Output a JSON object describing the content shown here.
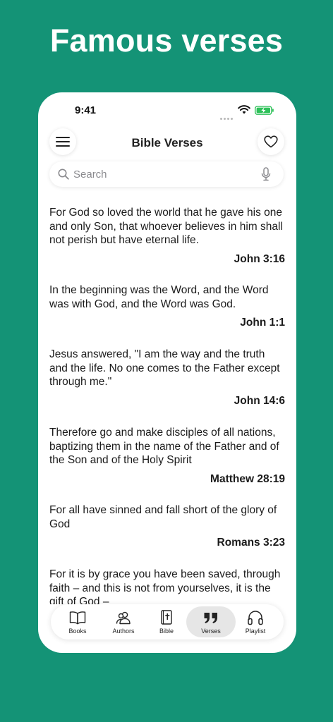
{
  "headline": "Famous verses",
  "status_bar": {
    "time": "9:41"
  },
  "navbar": {
    "title": "Bible Verses"
  },
  "search": {
    "placeholder": "Search"
  },
  "verses": [
    {
      "text": "For God so loved the world that he gave his one and only Son, that whoever believes in him shall not perish but have eternal life.",
      "reference": "John 3:16"
    },
    {
      "text": "In the beginning was the Word, and the Word was with God, and the Word was God.",
      "reference": "John 1:1"
    },
    {
      "text": "Jesus answered, \"I am the way and the truth and the life. No one comes to the Father except through me.\"",
      "reference": "John 14:6"
    },
    {
      "text": "Therefore go and make disciples of all nations, baptizing them in the name of the Father and of the Son and of the Holy Spirit",
      "reference": "Matthew 28:19"
    },
    {
      "text": "For all have sinned and fall short of the glory of God",
      "reference": "Romans 3:23"
    },
    {
      "text": "For it is by grace you have been saved, through faith – and this is not from yourselves, it is the gift of God –",
      "reference": ""
    }
  ],
  "tabs": [
    {
      "label": "Books",
      "icon": "book-icon"
    },
    {
      "label": "Authors",
      "icon": "authors-icon"
    },
    {
      "label": "Bible",
      "icon": "bible-icon"
    },
    {
      "label": "Verses",
      "icon": "quote-icon",
      "active": true
    },
    {
      "label": "Playlist",
      "icon": "headphones-icon"
    }
  ],
  "colors": {
    "background": "#149376",
    "card": "#ffffff",
    "active_tab": "#e6e6e6"
  }
}
